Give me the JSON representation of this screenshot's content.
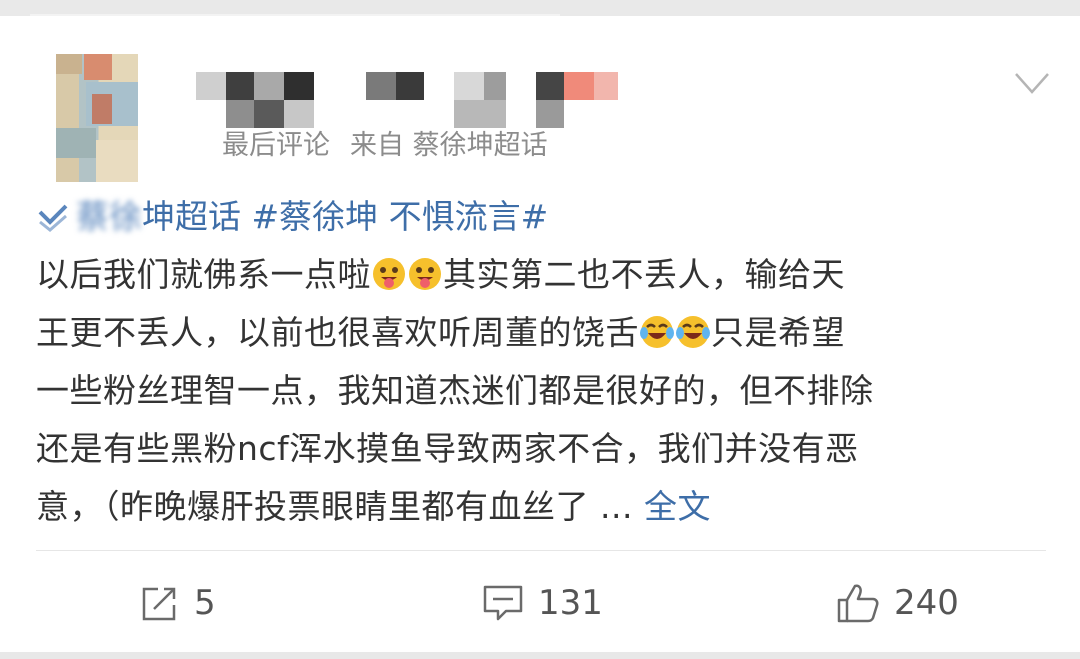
{
  "post": {
    "meta": {
      "last_comment": "最后评论",
      "source": "来自 蔡徐坤超话"
    },
    "topic_line": {
      "blurred_prefix": "蔡徐",
      "clear_part": "坤超话 #蔡徐坤 不惧流言#"
    },
    "lines": [
      "以后我们就佛系一点啦",
      "其实第二也不丢人，输给天",
      "王更不丢人，以前也很喜欢听周董的饶舌",
      "只是希望",
      "一些粉丝理智一点，我知道杰迷们都是很好的，但不排除",
      "还是有些黑粉ncf浑水摸鱼导致两家不合，我们并没有恶",
      "意，（昨晚爆肝投票眼睛里都有血丝了 ..."
    ],
    "more_label": "全文"
  },
  "actions": {
    "repost_count": "5",
    "comment_count": "131",
    "like_count": "240"
  },
  "colors": {
    "link": "#3e6ea8",
    "text": "#333333",
    "meta": "#8c8c8c"
  },
  "icons": [
    "chevron-down-icon",
    "super-topic-icon",
    "tongue-emoji",
    "laugh-cry-emoji",
    "repost-icon",
    "comment-icon",
    "like-icon"
  ]
}
